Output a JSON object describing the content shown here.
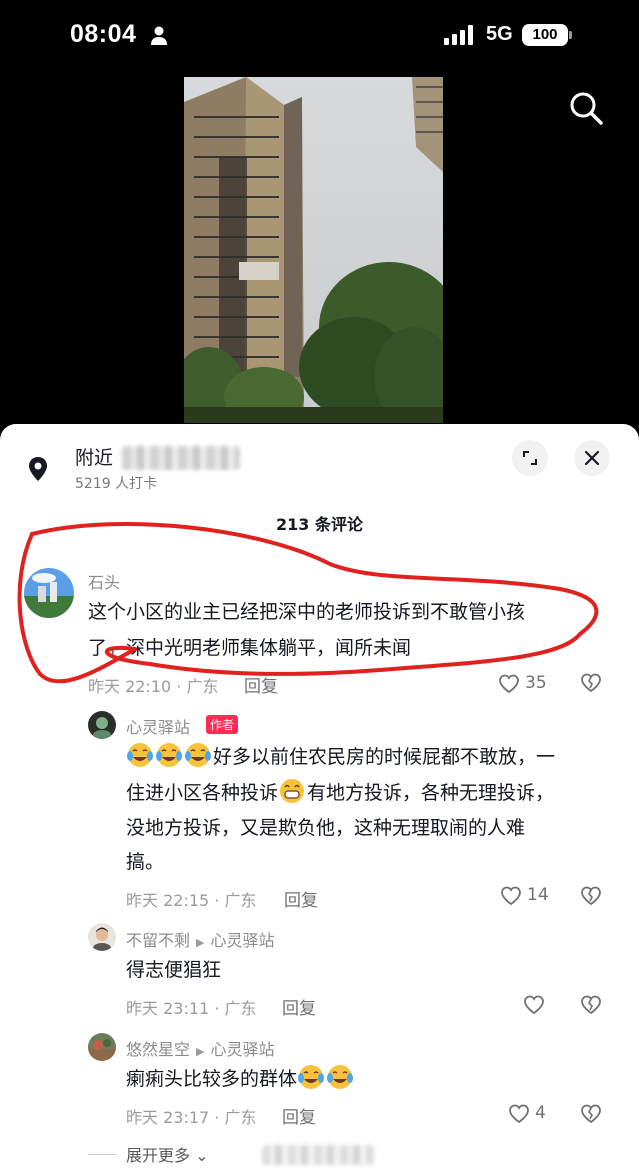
{
  "status_bar": {
    "time": "08:04",
    "network": "5G",
    "battery": "100"
  },
  "location": {
    "title": "附近",
    "checkins": "5219 人打卡"
  },
  "comments_header": {
    "count_label": "213 条评论"
  },
  "comments": [
    {
      "author": "石头",
      "text_line1": "这个小区的业主已经把深中的老师投诉到不敢管小孩",
      "text_line2": "了。深中光明老师集体躺平，闻所未闻",
      "time_location": "昨天 22:10 · 广东",
      "reply_label": "回复",
      "likes": "35"
    }
  ],
  "replies": [
    {
      "author": "心灵驿站",
      "badge": "作者",
      "emoji_prefix": [
        "face-with-tears-of-joy",
        "face-with-tears-of-joy",
        "face-with-tears-of-joy"
      ],
      "text_line1": "好多以前住农民房的时候屁都不敢放，一",
      "text_line2a": "住进小区各种投诉",
      "text_line2b": "有地方投诉，各种无理投诉，",
      "text_line3": "没地方投诉，又是欺负他，这种无理取闹的人难",
      "text_line4": "搞。",
      "time_location": "昨天 22:15 · 广东",
      "reply_label": "回复",
      "likes": "14"
    },
    {
      "author": "不留不剩",
      "reply_to": "心灵驿站",
      "text": "得志便猖狂",
      "time_location": "昨天 23:11 · 广东",
      "reply_label": "回复",
      "likes": ""
    },
    {
      "author": "悠然星空",
      "reply_to": "心灵驿站",
      "text": "瘌痢头比较多的群体",
      "time_location": "昨天 23:17 · 广东",
      "reply_label": "回复",
      "likes": "4"
    }
  ],
  "expand_more": {
    "label": "展开更多"
  },
  "icons": {
    "location": "map-pin-icon",
    "expand": "expand-icon",
    "close": "close-icon",
    "search": "search-icon",
    "like": "heart-icon",
    "dislike": "broken-heart-icon"
  },
  "colors": {
    "badge": "#fe2c55",
    "annotation": "#e0211d",
    "text": "#161823",
    "muted": "#9a9ba0"
  }
}
